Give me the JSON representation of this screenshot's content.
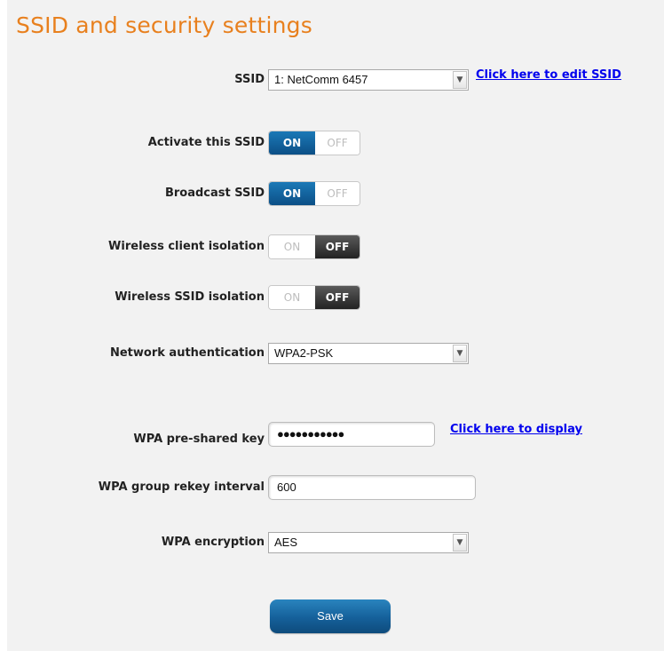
{
  "page": {
    "title": "SSID and security settings"
  },
  "ssid": {
    "label": "SSID",
    "selected": "1: NetComm 6457",
    "edit_link": "Click here to edit SSID"
  },
  "activate_ssid": {
    "label": "Activate this SSID",
    "on_label": "ON",
    "off_label": "OFF",
    "state": "on"
  },
  "broadcast_ssid": {
    "label": "Broadcast SSID",
    "on_label": "ON",
    "off_label": "OFF",
    "state": "on"
  },
  "client_isolation": {
    "label": "Wireless client isolation",
    "on_label": "ON",
    "off_label": "OFF",
    "state": "off"
  },
  "ssid_isolation": {
    "label": "Wireless SSID isolation",
    "on_label": "ON",
    "off_label": "OFF",
    "state": "off"
  },
  "network_auth": {
    "label": "Network authentication",
    "selected": "WPA2-PSK"
  },
  "psk": {
    "label": "WPA pre-shared key",
    "masked_value": "●●●●●●●●●●●",
    "display_link": "Click here to display"
  },
  "rekey": {
    "label": "WPA group rekey interval",
    "value": "600"
  },
  "encryption": {
    "label": "WPA encryption",
    "selected": "AES"
  },
  "actions": {
    "save_label": "Save"
  },
  "colors": {
    "title": "#e8801e",
    "toggle_on": "#0c4f86",
    "toggle_off": "#333333",
    "link": "#0000ee",
    "panel_bg": "#f2f2f2"
  }
}
